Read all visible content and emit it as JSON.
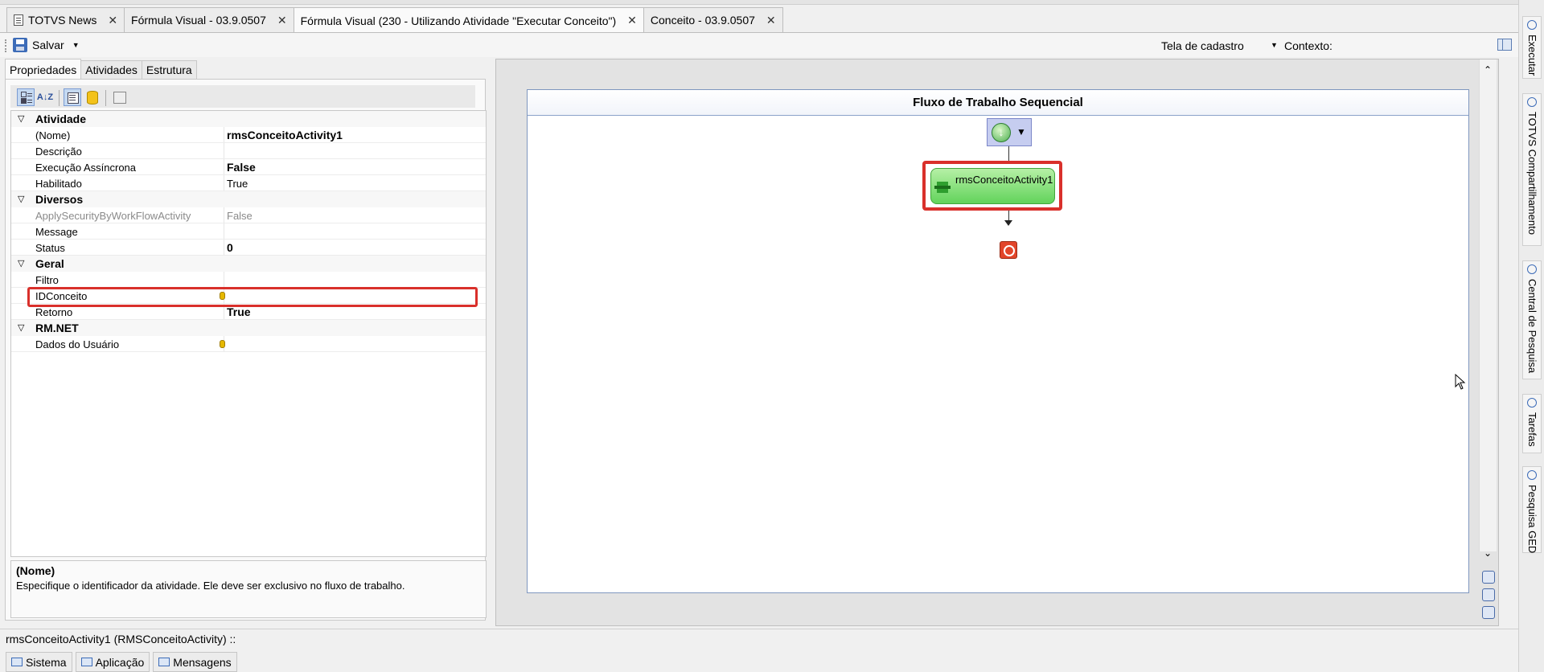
{
  "doc_tabs": [
    {
      "label": "TOTVS News"
    },
    {
      "label": "Fórmula Visual - 03.9.0507"
    },
    {
      "label": "Fórmula Visual (230 - Utilizando Atividade \"Executar Conceito\")"
    },
    {
      "label": "Conceito - 03.9.0507"
    }
  ],
  "toolbar": {
    "save_label": "Salvar",
    "screen_value": "Tela de cadastro",
    "context_label": "Contexto:"
  },
  "left_tabs": [
    {
      "label": "Propriedades"
    },
    {
      "label": "Atividades"
    },
    {
      "label": "Estrutura"
    }
  ],
  "grid": {
    "categories": [
      {
        "label": "Atividade",
        "rows": [
          {
            "name": "(Nome)",
            "value": "rmsConceitoActivity1"
          },
          {
            "name": "Descrição",
            "value": ""
          },
          {
            "name": "Execução Assíncrona",
            "value": "False"
          },
          {
            "name": "Habilitado",
            "value": "True"
          }
        ]
      },
      {
        "label": "Diversos",
        "rows": [
          {
            "name": "ApplySecurityByWorkFlowActivity",
            "value": "False"
          },
          {
            "name": "Message",
            "value": ""
          },
          {
            "name": "Status",
            "value": "0"
          }
        ]
      },
      {
        "label": "Geral",
        "rows": [
          {
            "name": "Filtro",
            "value": ""
          },
          {
            "name": "IDConceito",
            "value": ""
          },
          {
            "name": "Retorno",
            "value": "True"
          }
        ]
      },
      {
        "label": "RM.NET",
        "rows": [
          {
            "name": "Dados do Usuário",
            "value": ""
          }
        ]
      }
    ]
  },
  "description": {
    "title": "(Nome)",
    "text": "Especifique o identificador da atividade. Ele deve ser exclusivo no fluxo de trabalho."
  },
  "designer": {
    "title": "Fluxo de Trabalho Sequencial",
    "activity_label": "rmsConceitoActivity1"
  },
  "right_sidebar": [
    {
      "label": "Executar"
    },
    {
      "label": "TOTVS Compartilhamento"
    },
    {
      "label": "Central de Pesquisa"
    },
    {
      "label": "Tarefas"
    },
    {
      "label": "Pesquisa GED"
    }
  ],
  "status": {
    "text": "rmsConceitoActivity1  (RMSConceitoActivity)  ::"
  },
  "bottom_tabs": [
    {
      "label": "Sistema"
    },
    {
      "label": "Aplicação"
    },
    {
      "label": "Mensagens"
    }
  ],
  "colors": {
    "highlight": "#d9302b",
    "activity_fill": "#62d35b",
    "selected_tool": "#c5d9f1"
  }
}
